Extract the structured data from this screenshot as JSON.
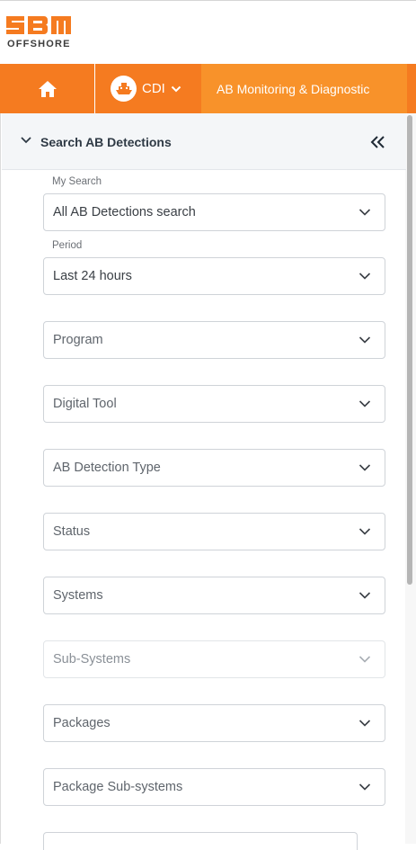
{
  "brand": {
    "logo_word": "SBM",
    "logo_sub": "OFFSHORE",
    "color": "#f57b20"
  },
  "nav": {
    "home_icon": "home-icon",
    "cdi_label": "CDI",
    "cdi_icon": "ship-icon",
    "active_label": "AB Monitoring & Diagnostic"
  },
  "panel": {
    "title": "Search AB Detections",
    "my_search_label": "My Search",
    "my_search_value": "All AB Detections search",
    "period_label": "Period",
    "period_value": "Last 24 hours",
    "filters": {
      "program": "Program",
      "digital_tool": "Digital Tool",
      "ab_detection_type": "AB Detection Type",
      "status": "Status",
      "systems": "Systems",
      "sub_systems": "Sub-Systems",
      "packages": "Packages",
      "package_sub_systems": "Package Sub-systems"
    }
  }
}
